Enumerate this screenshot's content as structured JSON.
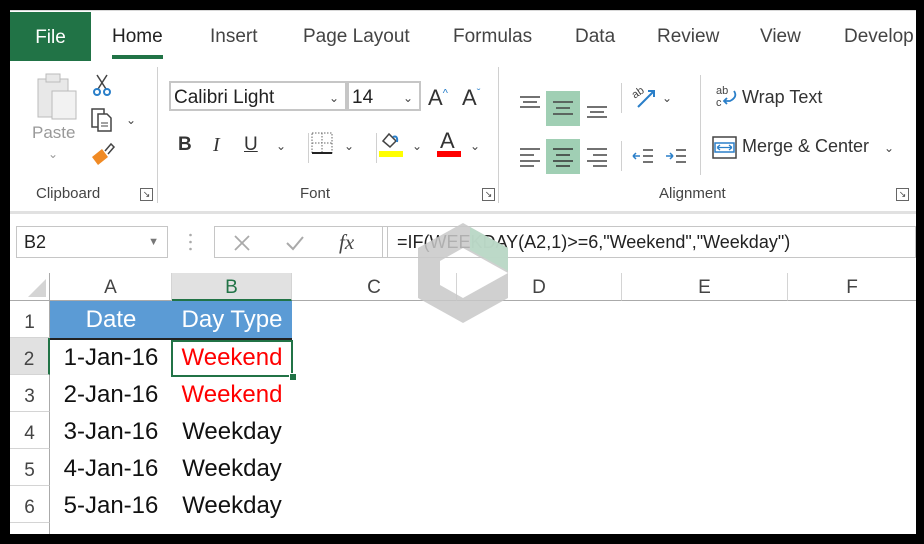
{
  "tabs": [
    {
      "label": "File"
    },
    {
      "label": "Home",
      "active": true
    },
    {
      "label": "Insert"
    },
    {
      "label": "Page Layout"
    },
    {
      "label": "Formulas"
    },
    {
      "label": "Data"
    },
    {
      "label": "Review"
    },
    {
      "label": "View"
    },
    {
      "label": "Develop"
    }
  ],
  "ribbon": {
    "clipboard": {
      "label": "Clipboard",
      "paste_label": "Paste"
    },
    "font": {
      "label": "Font",
      "font_name": "Calibri Light",
      "font_size": "14",
      "bold": "B",
      "italic": "I",
      "underline": "U",
      "fill_color": "#ffff00",
      "font_color": "#ff0000"
    },
    "alignment": {
      "label": "Alignment",
      "wrap_text": "Wrap Text",
      "merge_center": "Merge & Center"
    }
  },
  "formula_bar": {
    "name_box": "B2",
    "fx": "fx",
    "formula": "=IF(WEEKDAY(A2,1)>=6,\"Weekend\",\"Weekday\")"
  },
  "columns": [
    "A",
    "B",
    "C",
    "D",
    "E",
    "F"
  ],
  "rows": [
    "1",
    "2",
    "3",
    "4",
    "5",
    "6"
  ],
  "table": {
    "headers": [
      "Date",
      "Day Type"
    ],
    "header_bg": "#5b9bd5",
    "rows": [
      {
        "date": "1-Jan-16",
        "type": "Weekend",
        "weekend": true
      },
      {
        "date": "2-Jan-16",
        "type": "Weekend",
        "weekend": true
      },
      {
        "date": "3-Jan-16",
        "type": "Weekday",
        "weekend": false
      },
      {
        "date": "4-Jan-16",
        "type": "Weekday",
        "weekend": false
      },
      {
        "date": "5-Jan-16",
        "type": "Weekday",
        "weekend": false
      }
    ]
  },
  "selected_cell": "B2",
  "colors": {
    "accent": "#217346",
    "weekend_text": "#ff0000"
  }
}
